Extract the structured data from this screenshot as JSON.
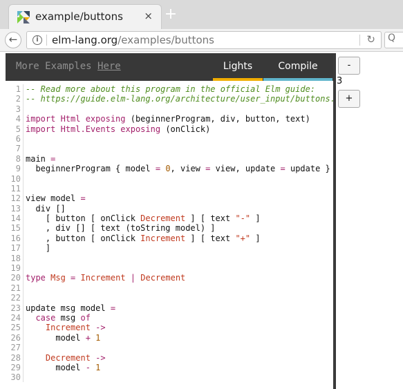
{
  "browser": {
    "tab_title": "example/buttons",
    "tab_close": "×",
    "new_tab": "+",
    "url_host": "elm-lang.org",
    "url_path": "/examples/buttons",
    "info_icon": "i",
    "reload_icon": "↻",
    "search_icon": "Q"
  },
  "editor": {
    "more_examples_label": "More Examples ",
    "here_label": "Here",
    "lights_label": "Lights",
    "compile_label": "Compile",
    "code_lines": [
      [
        [
          "-- Read more about this program in the official Elm guide:",
          "comment"
        ]
      ],
      [
        [
          "-- https://guide.elm-lang.org/architecture/user_input/buttons.html",
          "comment"
        ]
      ],
      [],
      [
        [
          "import ",
          "kw"
        ],
        [
          "Html",
          "mod"
        ],
        [
          " exposing ",
          "kw"
        ],
        [
          "(beginnerProgram, div, button, text)",
          ""
        ]
      ],
      [
        [
          "import ",
          "kw"
        ],
        [
          "Html.Events",
          "mod"
        ],
        [
          " exposing ",
          "kw"
        ],
        [
          "(onClick)",
          ""
        ]
      ],
      [],
      [],
      [
        [
          "main ",
          ""
        ],
        [
          "=",
          "kw"
        ]
      ],
      [
        [
          "  beginnerProgram { model ",
          ""
        ],
        [
          "=",
          "kw"
        ],
        [
          " ",
          ""
        ],
        [
          "0",
          "num"
        ],
        [
          ", view ",
          ""
        ],
        [
          "=",
          "kw"
        ],
        [
          " view, update ",
          ""
        ],
        [
          "=",
          "kw"
        ],
        [
          " update }",
          ""
        ]
      ],
      [],
      [],
      [
        [
          "view model ",
          ""
        ],
        [
          "=",
          "kw"
        ]
      ],
      [
        [
          "  div []",
          ""
        ]
      ],
      [
        [
          "    [ button [ onClick ",
          ""
        ],
        [
          "Decrement",
          "ctor"
        ],
        [
          " ] [ text ",
          ""
        ],
        [
          "\"-\"",
          "str"
        ],
        [
          " ]",
          ""
        ]
      ],
      [
        [
          "    , div [] [ text (toString model) ]",
          ""
        ]
      ],
      [
        [
          "    , button [ onClick ",
          ""
        ],
        [
          "Increment",
          "ctor"
        ],
        [
          " ] [ text ",
          ""
        ],
        [
          "\"+\"",
          "str"
        ],
        [
          " ]",
          ""
        ]
      ],
      [
        [
          "    ]",
          ""
        ]
      ],
      [],
      [],
      [
        [
          "type ",
          "kw"
        ],
        [
          "Msg",
          "ctor"
        ],
        [
          " ",
          ""
        ],
        [
          "=",
          "kw"
        ],
        [
          " ",
          ""
        ],
        [
          "Increment",
          "ctor"
        ],
        [
          " ",
          ""
        ],
        [
          "|",
          "kw"
        ],
        [
          " ",
          ""
        ],
        [
          "Decrement",
          "ctor"
        ]
      ],
      [],
      [],
      [
        [
          "update msg model ",
          ""
        ],
        [
          "=",
          "kw"
        ]
      ],
      [
        [
          "  ",
          ""
        ],
        [
          "case",
          "kw"
        ],
        [
          " msg ",
          ""
        ],
        [
          "of",
          "kw"
        ]
      ],
      [
        [
          "    ",
          ""
        ],
        [
          "Increment",
          "ctor"
        ],
        [
          " ",
          ""
        ],
        [
          "->",
          "kw"
        ]
      ],
      [
        [
          "      model ",
          ""
        ],
        [
          "+",
          "kw"
        ],
        [
          " ",
          ""
        ],
        [
          "1",
          "num"
        ]
      ],
      [],
      [
        [
          "    ",
          ""
        ],
        [
          "Decrement",
          "ctor"
        ],
        [
          " ",
          ""
        ],
        [
          "->",
          "kw"
        ]
      ],
      [
        [
          "      model ",
          ""
        ],
        [
          "-",
          "kw"
        ],
        [
          " ",
          ""
        ],
        [
          "1",
          "num"
        ]
      ],
      []
    ]
  },
  "output": {
    "decrement_label": "-",
    "counter_value": "3",
    "increment_label": "+"
  },
  "colors": {
    "lights_accent": "#f0ad00",
    "compile_accent": "#60b5cc",
    "topbar": "#383838"
  }
}
